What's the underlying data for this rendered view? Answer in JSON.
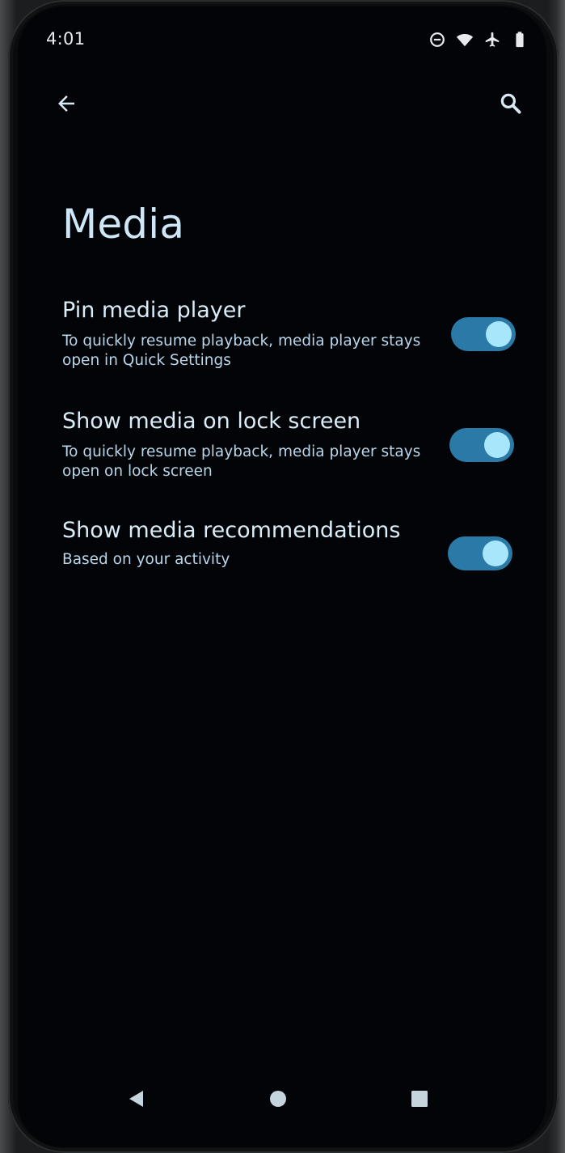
{
  "status_bar": {
    "time": "4:01",
    "icons": [
      "do-not-disturb-icon",
      "wifi-icon",
      "airplane-icon",
      "battery-icon"
    ]
  },
  "app_bar": {
    "back_icon": "arrow-back-icon",
    "search_icon": "search-icon"
  },
  "page": {
    "title": "Media"
  },
  "settings": [
    {
      "title": "Pin media player",
      "summary": "To quickly resume playback, media player stays open in Quick Settings",
      "enabled": true
    },
    {
      "title": "Show media on lock screen",
      "summary": "To quickly resume playback, media player stays open on lock screen",
      "enabled": true
    },
    {
      "title": "Show media recommendations",
      "summary": "Based on your activity",
      "enabled": true
    }
  ],
  "nav_bar": {
    "back_icon": "nav-back-triangle-icon",
    "home_icon": "nav-home-circle-icon",
    "recents_icon": "nav-recents-square-icon"
  },
  "colors": {
    "background": "#030407",
    "accent": "#2b79a6",
    "toggle_thumb": "#a7e6fb",
    "title_text": "#cfe6f6",
    "summary_text": "#b8d6ea"
  }
}
